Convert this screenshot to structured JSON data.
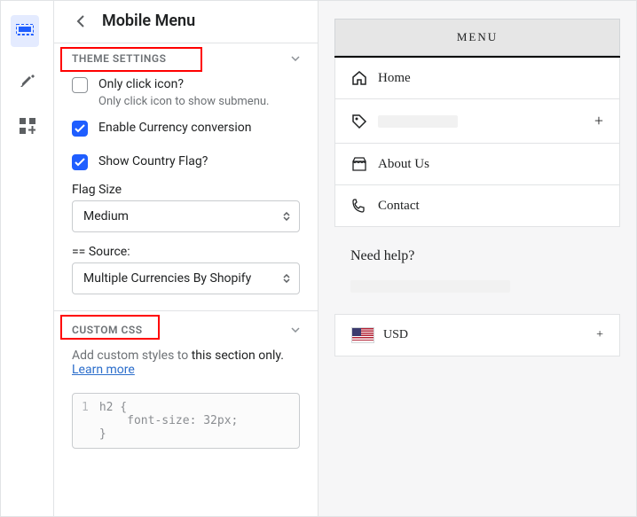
{
  "leftnav": {
    "items": [
      {
        "name": "sections-icon",
        "active": true
      },
      {
        "name": "theme-icon",
        "active": false
      },
      {
        "name": "apps-icon",
        "active": false
      }
    ]
  },
  "sidebar": {
    "title": "Mobile Menu",
    "sections": {
      "theme_settings": {
        "label": "THEME SETTINGS",
        "only_click": {
          "label": "Only click icon?",
          "helper": "Only click icon to show submenu.",
          "checked": false
        },
        "currency": {
          "label": "Enable Currency conversion",
          "checked": true
        },
        "country_flag": {
          "label": "Show Country Flag?",
          "checked": true
        },
        "flag_size": {
          "label": "Flag Size",
          "value": "Medium"
        },
        "source": {
          "label": "== Source:",
          "value": "Multiple Currencies By Shopify"
        }
      },
      "custom_css": {
        "label": "CUSTOM CSS",
        "helper_prefix": "Add custom styles to ",
        "helper_bold": "this section only.",
        "learn_more": "Learn more",
        "code": "h2 {\n    font-size: 32px;\n}",
        "line_no": "1"
      }
    }
  },
  "preview": {
    "menu_header": "MENU",
    "items": [
      {
        "icon": "home-icon",
        "label": "Home",
        "expandable": false
      },
      {
        "icon": "tag-icon",
        "label": "",
        "blurred": true,
        "expandable": true
      },
      {
        "icon": "store-icon",
        "label": "About Us",
        "expandable": false
      },
      {
        "icon": "phone-icon",
        "label": "Contact",
        "expandable": false
      }
    ],
    "need_help": "Need help?",
    "currency": {
      "code": "USD",
      "expandable": true
    }
  }
}
